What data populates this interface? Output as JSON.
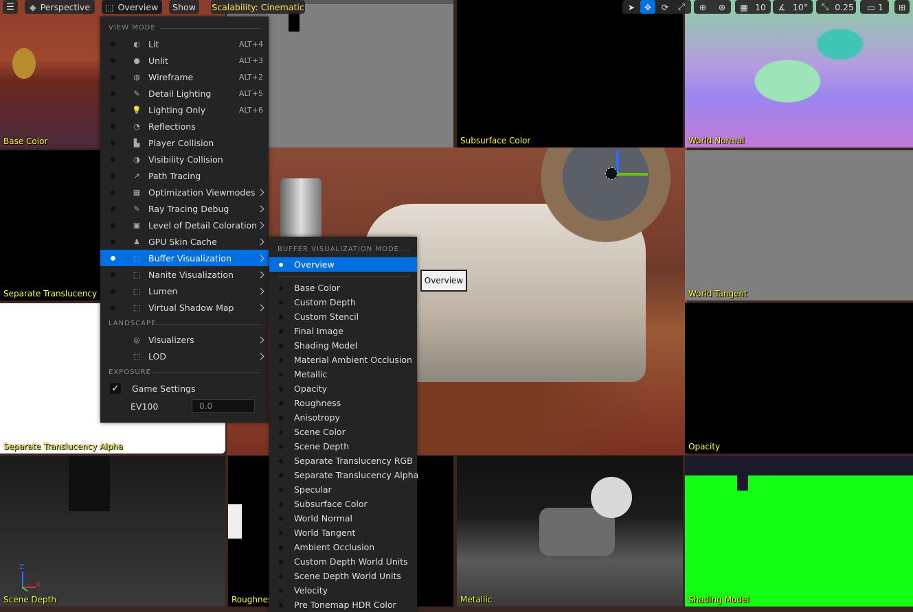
{
  "toolbar": {
    "perspective_label": "Perspective",
    "view_mode_label": "Overview",
    "show_label": "Show",
    "scalability_label": "Scalability: Cinematic",
    "grid_snap_value": "10",
    "rotation_snap_value": "10°",
    "scale_snap_value": "0.25",
    "camera_speed_value": "1"
  },
  "tiles": {
    "base_color": "Base Color",
    "subsurface_color": "Subsurface Color",
    "world_normal": "World Normal",
    "separate_translucency_rgb": "Separate Translucency RGB",
    "world_tangent": "World Tangent",
    "separate_translucency_alpha": "Separate Translucency Alpha",
    "opacity": "Opacity",
    "scene_depth": "Scene Depth",
    "roughness": "Roughness",
    "metallic": "Metallic",
    "shading_model": "Shading Model"
  },
  "tooltip": "Overview",
  "view_mode_menu": {
    "section_view_mode": "View Mode",
    "items": [
      {
        "label": "Lit",
        "shortcut": "ALT+4",
        "icon": "lit-icon"
      },
      {
        "label": "Unlit",
        "shortcut": "ALT+3",
        "icon": "unlit-icon"
      },
      {
        "label": "Wireframe",
        "shortcut": "ALT+2",
        "icon": "wireframe-icon"
      },
      {
        "label": "Detail Lighting",
        "shortcut": "ALT+5",
        "icon": "detail-lighting-icon"
      },
      {
        "label": "Lighting Only",
        "shortcut": "ALT+6",
        "icon": "lighting-only-icon"
      },
      {
        "label": "Reflections",
        "shortcut": "",
        "icon": "reflections-icon"
      },
      {
        "label": "Player Collision",
        "shortcut": "",
        "icon": "player-collision-icon"
      },
      {
        "label": "Visibility Collision",
        "shortcut": "",
        "icon": "visibility-collision-icon"
      },
      {
        "label": "Path Tracing",
        "shortcut": "",
        "icon": "path-tracing-icon"
      },
      {
        "label": "Optimization Viewmodes",
        "shortcut": "",
        "icon": "optimization-icon"
      },
      {
        "label": "Ray Tracing Debug",
        "shortcut": "",
        "icon": "ray-tracing-icon"
      },
      {
        "label": "Level of Detail Coloration",
        "shortcut": "",
        "icon": "lod-coloration-icon"
      },
      {
        "label": "GPU Skin Cache",
        "shortcut": "",
        "icon": "skin-cache-icon"
      },
      {
        "label": "Buffer Visualization",
        "shortcut": "",
        "icon": "buffer-visualization-icon"
      },
      {
        "label": "Nanite Visualization",
        "shortcut": "",
        "icon": "nanite-icon"
      },
      {
        "label": "Lumen",
        "shortcut": "",
        "icon": "lumen-icon"
      },
      {
        "label": "Virtual Shadow Map",
        "shortcut": "",
        "icon": "shadow-map-icon"
      }
    ],
    "section_landscape": "Landscape",
    "landscape_items": [
      {
        "label": "Visualizers",
        "icon": "visualizers-icon"
      },
      {
        "label": "LOD",
        "icon": "lod-icon"
      }
    ],
    "section_exposure": "Exposure",
    "game_settings_label": "Game Settings",
    "game_settings_checked": true,
    "ev100_label": "EV100",
    "ev100_value": "0.0"
  },
  "buffer_menu": {
    "section": "Buffer Visualization Mode",
    "overview_label": "Overview",
    "items": [
      "Base Color",
      "Custom Depth",
      "Custom Stencil",
      "Final Image",
      "Shading Model",
      "Material Ambient Occlusion",
      "Metallic",
      "Opacity",
      "Roughness",
      "Anisotropy",
      "Scene Color",
      "Scene Depth",
      "Separate Translucency RGB",
      "Separate Translucency Alpha",
      "Specular",
      "Subsurface Color",
      "World Normal",
      "World Tangent",
      "Ambient Occlusion",
      "Custom Depth World Units",
      "Scene Depth World Units",
      "Velocity",
      "Pre Tonemap HDR Color"
    ]
  },
  "axis_labels": {
    "z": "Z",
    "x": "X"
  },
  "colors": {
    "label_yellow": "#ffff33",
    "selection_blue": "#0070e0",
    "menu_bg": "#242424",
    "green_shading": "#13ff13"
  }
}
